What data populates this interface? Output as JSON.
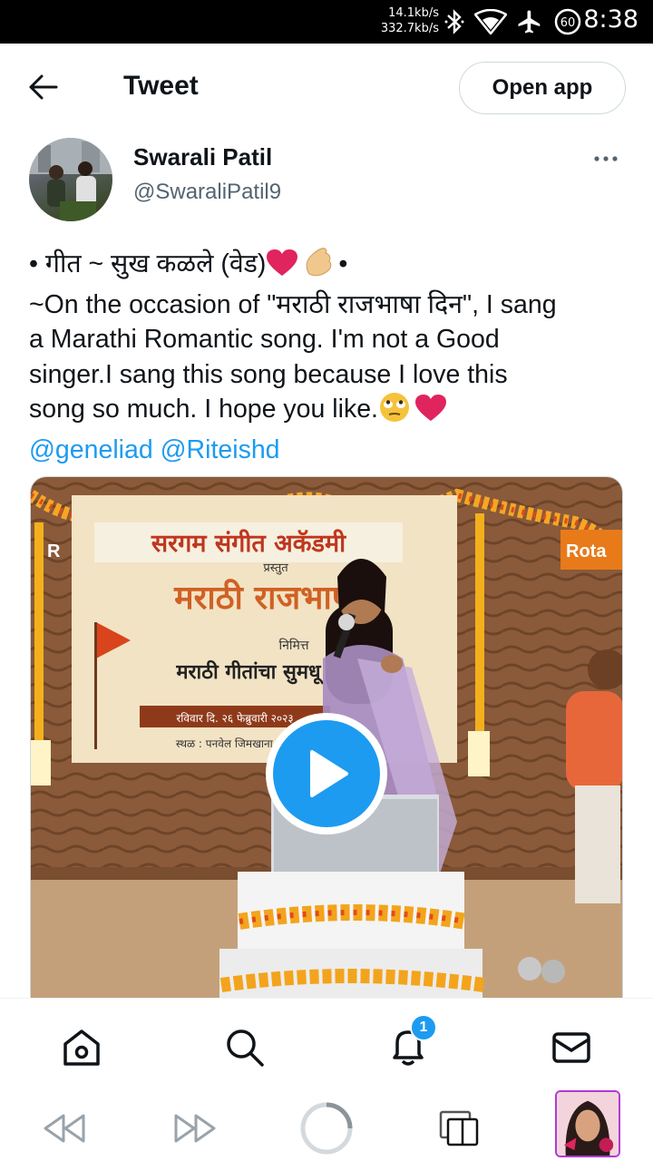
{
  "status_bar": {
    "net_up": "14.1kb/s",
    "net_down": "332.7kb/s",
    "battery": "60",
    "time": "8:38",
    "icons": [
      "bluetooth-icon",
      "wifi-icon",
      "airplane-icon",
      "battery-icon"
    ]
  },
  "header": {
    "title": "Tweet",
    "open_app_label": "Open app",
    "back_icon": "back-arrow-icon"
  },
  "author": {
    "name": "Swarali Patil",
    "handle": "@SwaraliPatil9"
  },
  "tweet": {
    "line1": "• गीत ~ सुख कळले (वेड)",
    "line1_end": "•",
    "line2": "~On the occasion of \"मराठी राजभाषा दिन\", I sang",
    "line3": "a Marathi Romantic song. I'm not a Good",
    "line4": "singer.I sang this song because I love this",
    "line5": "song so much. I hope you like.",
    "mentions": [
      "@geneliad",
      "@Riteishd"
    ]
  },
  "media": {
    "banner_text_1": "सरगम संगीत अकॅडमी",
    "banner_text_2": "प्रस्तुत",
    "banner_text_3": "मराठी राजभाषा",
    "banner_text_4": "निमित्त",
    "banner_text_5": "मराठी गीतांचा सुमधू",
    "banner_text_6": "रविवार दि. २६ फेब्रुवारी २०२३",
    "banner_text_7": "स्थळ : पनवेल जिमखाना हॉ",
    "banner_text_8": "Rota",
    "banner_text_9": "R"
  },
  "bottom_nav": {
    "items": [
      "home-icon",
      "search-icon",
      "notifications-icon",
      "messages-icon"
    ],
    "notification_count": "1"
  },
  "system_nav": {
    "items": [
      "rewind-icon",
      "fast-forward-icon",
      "loading-icon",
      "tabs-icon",
      "app-thumbnail"
    ]
  },
  "colors": {
    "accent": "#1d9bf0",
    "heart": "#e0245e",
    "text": "#0f1419",
    "secondary": "#536471"
  }
}
